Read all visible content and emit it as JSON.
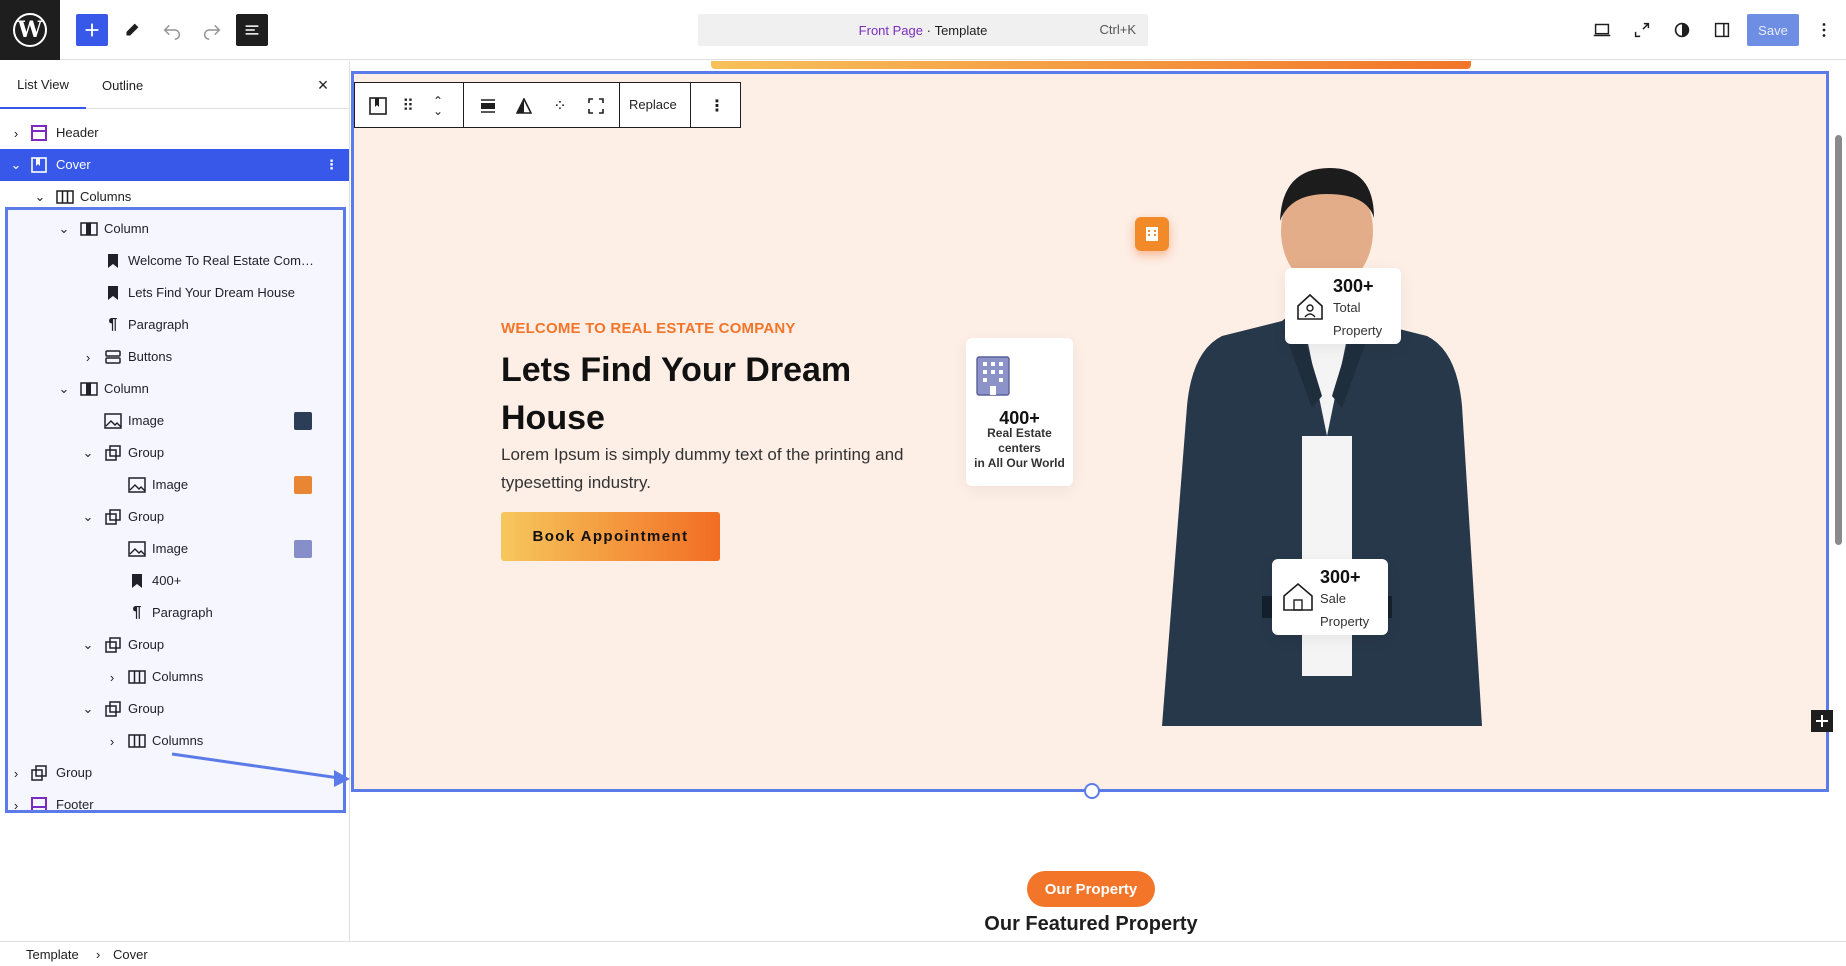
{
  "topbar": {
    "command": {
      "page": "Front Page",
      "type": "Template",
      "shortcut": "Ctrl+K"
    },
    "save_label": "Save"
  },
  "sidebar": {
    "tabs": [
      "List View",
      "Outline"
    ],
    "close": "×",
    "rows": [
      {
        "label": "Header"
      },
      {
        "label": "Cover"
      },
      {
        "label": "Columns"
      },
      {
        "label": "Column"
      },
      {
        "label": "Welcome To Real Estate Com…"
      },
      {
        "label": "Lets Find Your Dream House"
      },
      {
        "label": "Paragraph"
      },
      {
        "label": "Buttons"
      },
      {
        "label": "Column"
      },
      {
        "label": "Image"
      },
      {
        "label": "Group"
      },
      {
        "label": "Image"
      },
      {
        "label": "Group"
      },
      {
        "label": "Image"
      },
      {
        "label": "400+"
      },
      {
        "label": "Paragraph"
      },
      {
        "label": "Group"
      },
      {
        "label": "Columns"
      },
      {
        "label": "Group"
      },
      {
        "label": "Columns"
      },
      {
        "label": "Group"
      },
      {
        "label": "Footer"
      }
    ]
  },
  "toolbar": {
    "replace_label": "Replace"
  },
  "hero": {
    "eyebrow": "WELCOME TO REAL ESTATE COMPANY",
    "title": "Lets Find Your Dream House",
    "lead": "Lorem Ipsum is simply dummy text of the printing and typesetting industry.",
    "cta": "Book Appointment"
  },
  "stats": {
    "total": {
      "num": "300+",
      "l1": "Total",
      "l2": "Property"
    },
    "centers": {
      "num": "400+",
      "l1": "Real Estate",
      "l2": "centers",
      "l3": "in All Our World"
    },
    "sale": {
      "num": "300+",
      "l1": "Sale",
      "l2": "Property"
    }
  },
  "property": {
    "pill": "Our Property",
    "title": "Our Featured Property"
  },
  "breadcrumb": [
    "Template",
    "Cover"
  ],
  "colors": {
    "accent": "#3858e9",
    "orange": "#f2752a",
    "cover_bg": "#fdeee6"
  }
}
